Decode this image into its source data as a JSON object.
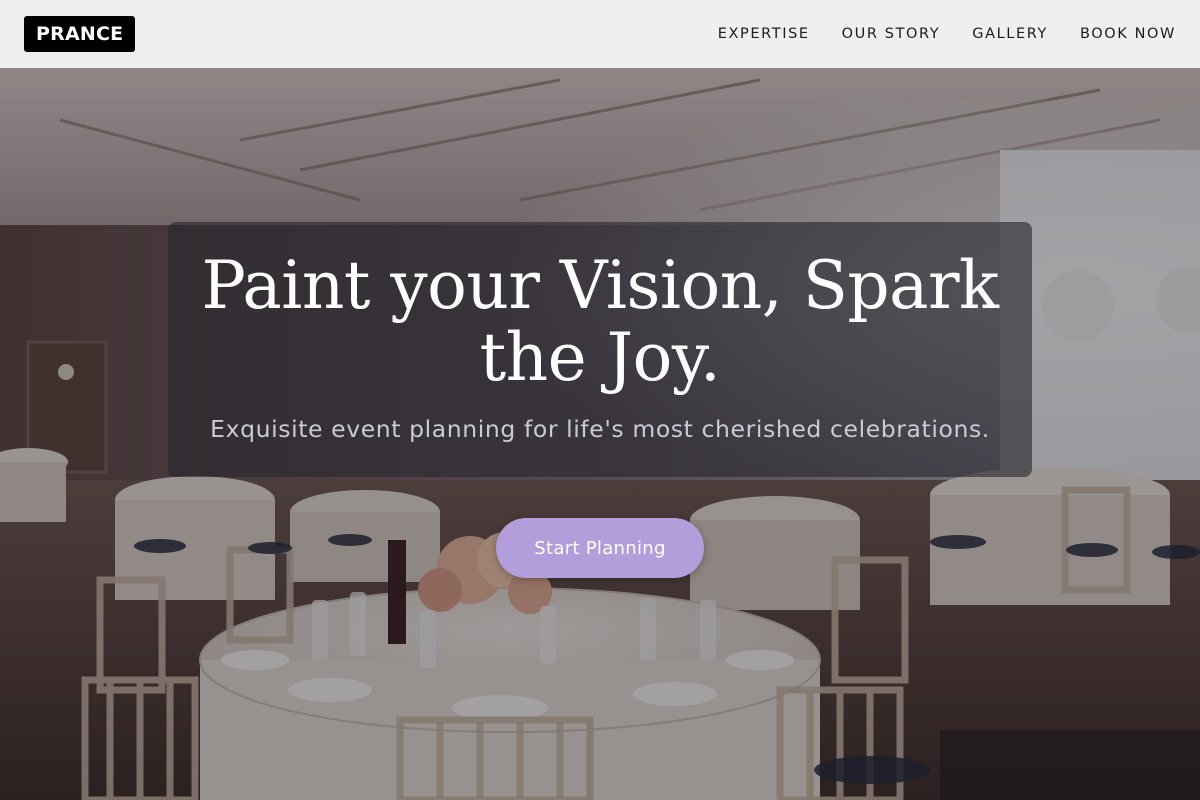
{
  "header": {
    "logo_text": "PRANCE",
    "nav": [
      {
        "label": "EXPERTISE"
      },
      {
        "label": "OUR STORY"
      },
      {
        "label": "GALLERY"
      },
      {
        "label": "BOOK NOW"
      }
    ]
  },
  "hero": {
    "title_line1": "Paint your Vision, Spark",
    "title_line2": "the Joy.",
    "subtitle": "Exquisite event planning for life's most cherished celebrations.",
    "cta_label": "Start Planning",
    "background": "banquet-hall-photo"
  },
  "colors": {
    "header_bg": "#efefef",
    "logo_bg": "#000000",
    "cta_bg": "#b39ddb",
    "subtitle": "#c9ccd3"
  }
}
